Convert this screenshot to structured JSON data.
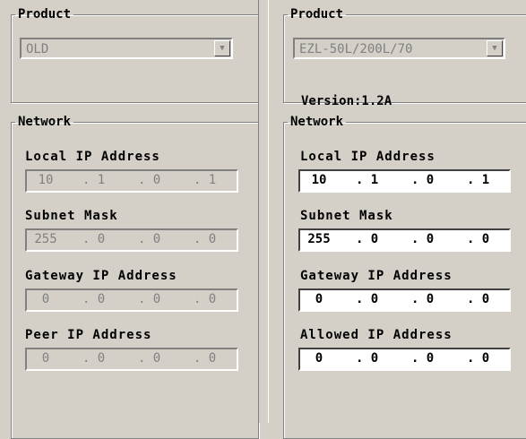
{
  "left": {
    "product": {
      "legend": "Product",
      "combo_value": "OLD"
    },
    "network": {
      "legend": "Network",
      "fields": [
        {
          "label": "Local IP Address",
          "octets": [
            "10",
            "1",
            "0",
            "1"
          ]
        },
        {
          "label": "Subnet Mask",
          "octets": [
            "255",
            "0",
            "0",
            "0"
          ]
        },
        {
          "label": "Gateway IP Address",
          "octets": [
            "0",
            "0",
            "0",
            "0"
          ]
        },
        {
          "label": "Peer IP Address",
          "octets": [
            "0",
            "0",
            "0",
            "0"
          ]
        }
      ]
    }
  },
  "right": {
    "product": {
      "legend": "Product",
      "combo_value": "EZL-50L/200L/70",
      "version": "Version:1.2A"
    },
    "network": {
      "legend": "Network",
      "fields": [
        {
          "label": "Local IP Address",
          "octets": [
            "10",
            "1",
            "0",
            "1"
          ]
        },
        {
          "label": "Subnet Mask",
          "octets": [
            "255",
            "0",
            "0",
            "0"
          ]
        },
        {
          "label": "Gateway IP Address",
          "octets": [
            "0",
            "0",
            "0",
            "0"
          ]
        },
        {
          "label": "Allowed IP Address",
          "octets": [
            "0",
            "0",
            "0",
            "0"
          ]
        }
      ]
    }
  },
  "icons": {
    "dropdown": "chevron-down-icon"
  },
  "colors": {
    "panel": "#d4d0c8",
    "disabled_text": "#808080",
    "field_bg": "#ffffff"
  }
}
